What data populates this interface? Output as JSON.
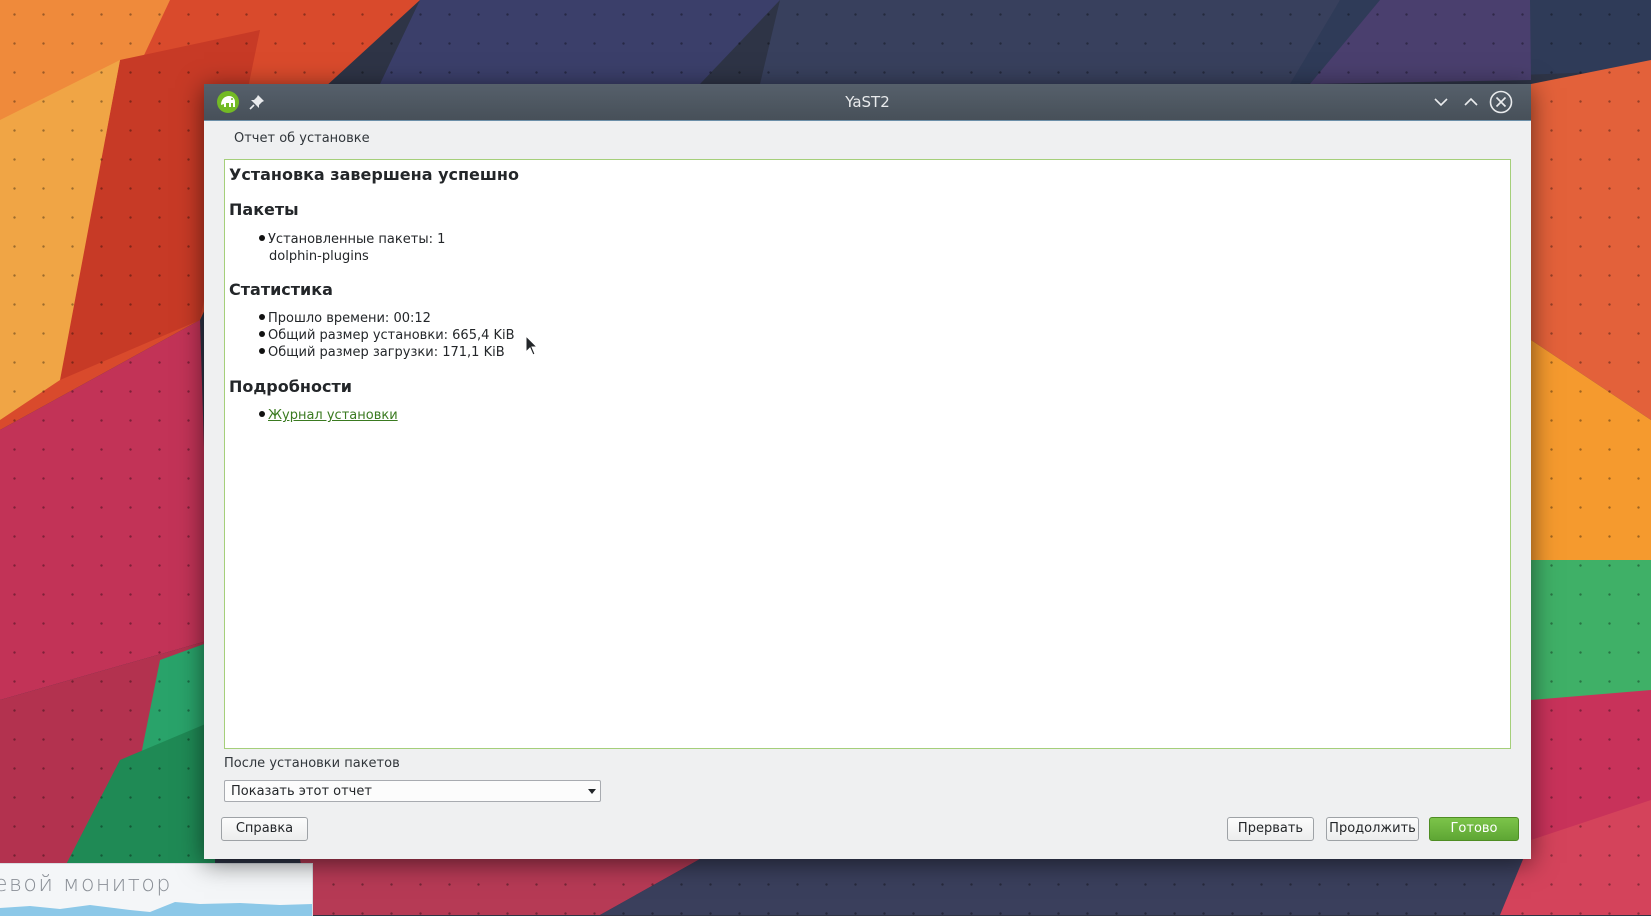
{
  "window": {
    "title": "YaST2",
    "app_icon": "yast-chameleon-icon",
    "pin_icon": "pin-icon",
    "controls": [
      "minimize-icon",
      "maximize-icon",
      "close-icon"
    ]
  },
  "breadcrumb": "Отчет об установке",
  "report": {
    "heading": "Установка завершена успешно",
    "sections": {
      "packages": {
        "title": "Пакеты",
        "installed_label": "Установленные пакеты: 1",
        "installed_list": "dolphin-plugins"
      },
      "statistics": {
        "title": "Статистика",
        "elapsed": "Прошло времени: 00:12",
        "install_size": "Общий размер установки: 665,4 KiB",
        "download_size": "Общий размер загрузки: 171,1 KiB"
      },
      "details": {
        "title": "Подробности",
        "log_link": "Журнал установки"
      }
    }
  },
  "after_install": {
    "label": "После установки пакетов",
    "selected": "Показать этот отчет"
  },
  "buttons": {
    "help": "Справка",
    "abort": "Прервать",
    "continue": "Продолжить",
    "finish": "Готово"
  },
  "desktop": {
    "widget_title": "евой монитор"
  },
  "colors": {
    "accent_green": "#6bb53f",
    "link_green": "#3a7a20",
    "titlebar": "#4d565f"
  }
}
